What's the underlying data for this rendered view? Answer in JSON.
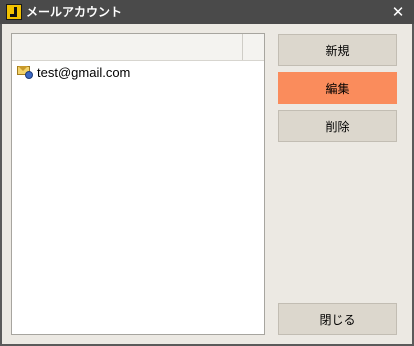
{
  "window": {
    "title": "メールアカウント",
    "close_label": "✕"
  },
  "accounts": [
    {
      "label": "test@gmail.com"
    }
  ],
  "buttons": {
    "new_label": "新規",
    "edit_label": "編集",
    "delete_label": "削除",
    "close_label": "閉じる"
  },
  "colors": {
    "active_button": "#fa8c5c",
    "titlebar": "#4a4a4a",
    "dialog_background": "#ece9e3"
  },
  "icons": {
    "app": "app-logo-icon",
    "account": "mail-account-icon",
    "close": "close-icon"
  }
}
